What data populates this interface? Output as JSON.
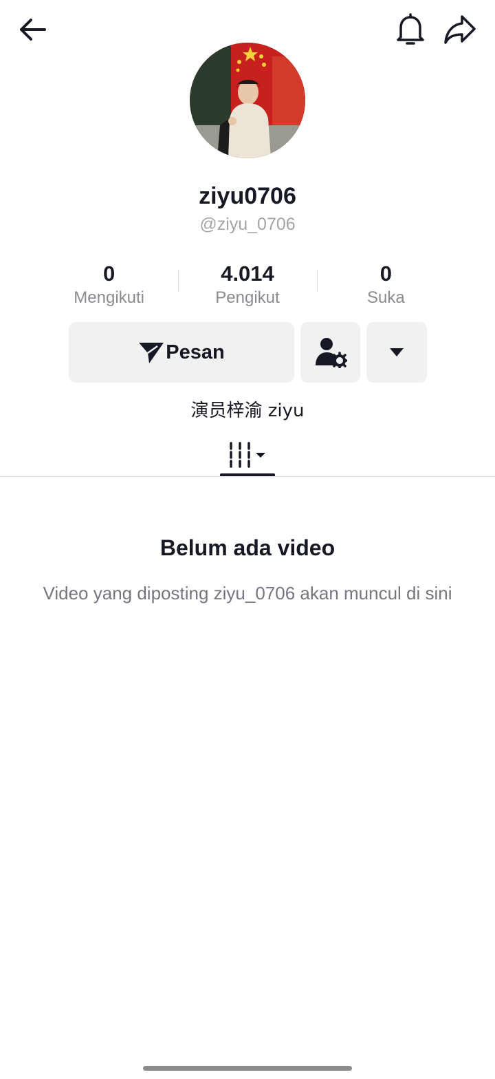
{
  "header": {
    "back_icon": "arrow-left-icon",
    "bell_icon": "bell-icon",
    "share_icon": "share-arrow-icon"
  },
  "profile": {
    "display_name": "ziyu0706",
    "handle": "@ziyu_0706",
    "bio": "演员梓渝 ziyu"
  },
  "stats": [
    {
      "value": "0",
      "label": "Mengikuti"
    },
    {
      "value": "4.014",
      "label": "Pengikut"
    },
    {
      "value": "0",
      "label": "Suka"
    }
  ],
  "actions": {
    "message_label": "Pesan",
    "message_icon": "paper-plane-icon",
    "friend_icon": "person-gear-icon",
    "more_icon": "caret-down-icon"
  },
  "tabs": {
    "videos_icon": "grid-filter-icon"
  },
  "empty_state": {
    "title": "Belum ada video",
    "description": "Video yang diposting ziyu_0706 akan muncul di sini"
  },
  "colors": {
    "text_primary": "#161823",
    "text_secondary": "#8a8b91",
    "button_bg": "#f1f1f2"
  }
}
